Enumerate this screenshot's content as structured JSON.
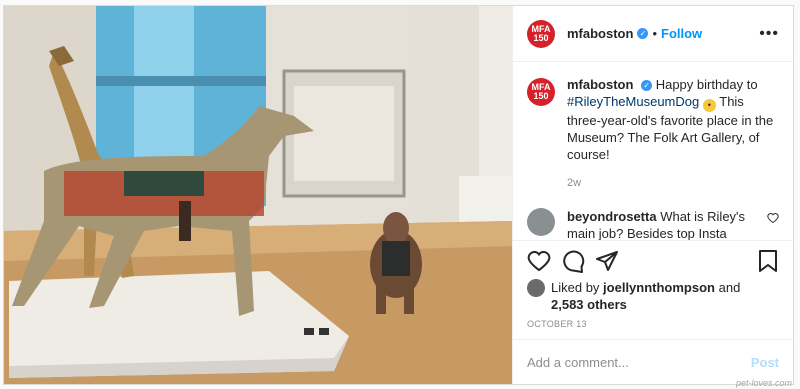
{
  "post": {
    "username": "mfaboston",
    "avatar_text_top": "MFA",
    "avatar_text_bottom": "150",
    "follow_label": "Follow",
    "dot": "•",
    "more_label": "•••",
    "caption_pre": "Happy birthday to",
    "caption_hashtag": "#RileyTheMuseumDog",
    "caption_post": "This three-year-old's favorite place in the Museum? The Folk Art Gallery, of course!",
    "caption_time": "2w",
    "comment_user": "beyondrosetta",
    "comment_text": "What is Riley's main job? Besides top Insta content of course",
    "liked_by_prefix": "Liked by",
    "liked_by_user": "joellynnthompson",
    "liked_by_and": "and",
    "others_count": "2,583 others",
    "date": "OCTOBER 13",
    "add_comment_placeholder": "Add a comment...",
    "post_label": "Post"
  },
  "icons": [
    "verified-icon",
    "more-icon",
    "heart-icon",
    "comment-icon",
    "share-icon",
    "bookmark-icon"
  ],
  "colors": {
    "accent": "#0095f6",
    "avatar": "#d6212a"
  },
  "watermark": "pet-loves.com"
}
